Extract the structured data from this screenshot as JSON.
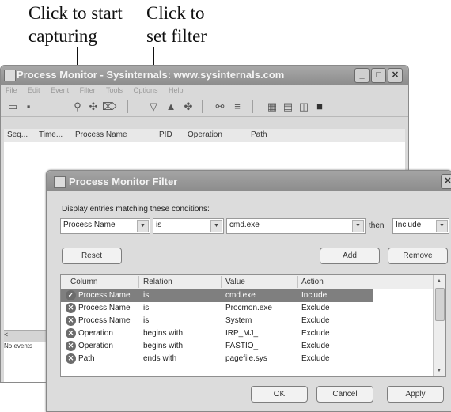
{
  "callouts": {
    "capture": [
      "Click to start",
      "capturing"
    ],
    "filter": [
      "Click to",
      "set filter"
    ]
  },
  "process_monitor": {
    "title": "Process Monitor - Sysinternals: www.sysinternals.com",
    "menu": [
      "File",
      "Edit",
      "Event",
      "Filter",
      "Tools",
      "Options",
      "Help"
    ],
    "toolbar_icons": [
      "open-icon",
      "save-icon",
      "capture-icon",
      "autoscroll-icon",
      "clear-icon",
      "filter-icon",
      "highlight-icon",
      "process-tree-icon",
      "find-icon",
      "jump-icon",
      "registry-icon",
      "file-icon",
      "network-icon",
      "process-icon"
    ],
    "columns": [
      "Seq...",
      "Time...",
      "Process Name",
      "PID",
      "Operation",
      "Path"
    ],
    "status": "No events"
  },
  "filter_dialog": {
    "title": "Process Monitor Filter",
    "prompt": "Display entries matching these conditions:",
    "column_value": "Process Name",
    "relation_value": "is",
    "value": "cmd.exe",
    "then_label": "then",
    "action_value": "Include",
    "buttons": {
      "reset": "Reset",
      "add": "Add",
      "remove": "Remove",
      "ok": "OK",
      "cancel": "Cancel",
      "apply": "Apply"
    },
    "grid_columns": [
      "Column",
      "Relation",
      "Value",
      "Action"
    ],
    "rows": [
      {
        "column": "Process Name",
        "relation": "is",
        "value": "cmd.exe",
        "action": "Include"
      },
      {
        "column": "Process Name",
        "relation": "is",
        "value": "Procmon.exe",
        "action": "Exclude"
      },
      {
        "column": "Process Name",
        "relation": "is",
        "value": "System",
        "action": "Exclude"
      },
      {
        "column": "Operation",
        "relation": "begins with",
        "value": "IRP_MJ_",
        "action": "Exclude"
      },
      {
        "column": "Operation",
        "relation": "begins with",
        "value": "FASTIO_",
        "action": "Exclude"
      },
      {
        "column": "Path",
        "relation": "ends with",
        "value": "pagefile.sys",
        "action": "Exclude"
      }
    ]
  }
}
